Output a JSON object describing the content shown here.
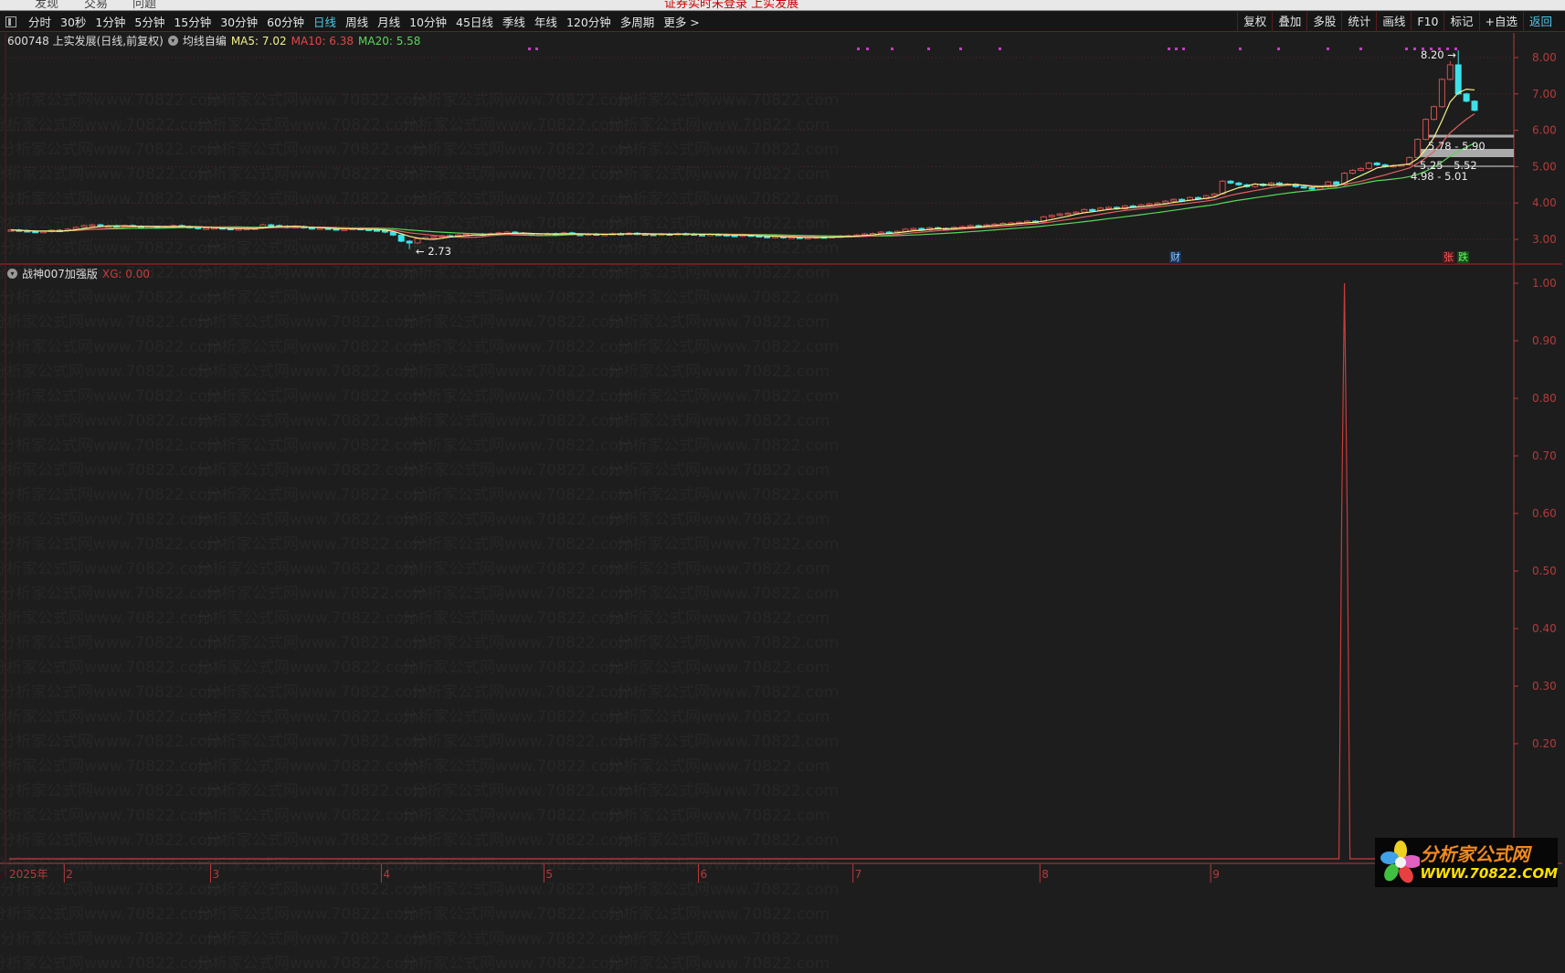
{
  "window": {
    "menu": [
      "发现",
      "交易",
      "问题"
    ],
    "title": "证券实时未登录 上实发展"
  },
  "toolbar": {
    "periods": [
      "分时",
      "30秒",
      "1分钟",
      "5分钟",
      "15分钟",
      "30分钟",
      "60分钟",
      "日线",
      "周线",
      "月线",
      "10分钟",
      "45日线",
      "季线",
      "年线",
      "120分钟",
      "多周期",
      "更多 >"
    ],
    "active_period": "日线",
    "actions": [
      "复权",
      "叠加",
      "多股",
      "统计",
      "画线",
      "F10",
      "标记",
      "+自选",
      "返回"
    ]
  },
  "main_chart": {
    "title": "600748 上实发展(日线,前复权)",
    "ma_label": "均线自编",
    "ma5": "MA5: 7.02",
    "ma10": "MA10: 6.38",
    "ma20": "MA20: 5.58",
    "high_label": "8.20",
    "low_label": "2.73",
    "levels": [
      "5.78 - 5.90",
      "5.25 - 5.52",
      "4.98 - 5.01"
    ],
    "badges": {
      "cai": "财",
      "zhang": "张",
      "die": "跌"
    },
    "colors": {
      "up": "#d05050",
      "down": "#3fe0e8",
      "ma5": "#f5f08a",
      "ma10": "#e06060",
      "ma20": "#58d858",
      "dots": "#c040c0",
      "axis": "#b43b3b"
    }
  },
  "indicator": {
    "title": "战神007加强版",
    "value_label": "XG: 0.00"
  },
  "x_axis": {
    "labels": [
      "2025年",
      "2",
      "3",
      "4",
      "5",
      "6",
      "7",
      "8",
      "9"
    ]
  },
  "watermark": "分析家公式网www.70822.com",
  "logo": {
    "line1": "分析家公式网",
    "line2": "WWW.70822.COM"
  },
  "chart_data": [
    {
      "type": "candlestick",
      "ylim": [
        2.7,
        8.4
      ],
      "yticks": [
        "8.00",
        "7.00",
        "6.00",
        "5.00",
        "4.00",
        "3.00"
      ],
      "grid": true,
      "closes": [
        3.26,
        3.24,
        3.22,
        3.2,
        3.22,
        3.25,
        3.24,
        3.28,
        3.33,
        3.38,
        3.4,
        3.36,
        3.37,
        3.35,
        3.38,
        3.36,
        3.33,
        3.35,
        3.34,
        3.36,
        3.38,
        3.35,
        3.33,
        3.3,
        3.31,
        3.32,
        3.3,
        3.28,
        3.29,
        3.3,
        3.31,
        3.4,
        3.38,
        3.36,
        3.33,
        3.35,
        3.32,
        3.3,
        3.31,
        3.29,
        3.27,
        3.28,
        3.3,
        3.28,
        3.26,
        3.25,
        3.2,
        3.12,
        2.95,
        2.9,
        3.02,
        3.05,
        3.08,
        3.1,
        3.08,
        3.12,
        3.14,
        3.15,
        3.12,
        3.16,
        3.18,
        3.2,
        3.17,
        3.15,
        3.12,
        3.14,
        3.16,
        3.15,
        3.18,
        3.14,
        3.12,
        3.15,
        3.13,
        3.14,
        3.16,
        3.15,
        3.17,
        3.15,
        3.14,
        3.13,
        3.15,
        3.14,
        3.16,
        3.15,
        3.13,
        3.12,
        3.14,
        3.13,
        3.11,
        3.1,
        3.12,
        3.1,
        3.08,
        3.06,
        3.08,
        3.05,
        3.06,
        3.04,
        3.05,
        3.07,
        3.06,
        3.08,
        3.09,
        3.1,
        3.12,
        3.15,
        3.16,
        3.2,
        3.18,
        3.22,
        3.28,
        3.3,
        3.26,
        3.32,
        3.3,
        3.28,
        3.33,
        3.35,
        3.38,
        3.36,
        3.4,
        3.42,
        3.44,
        3.45,
        3.47,
        3.5,
        3.48,
        3.62,
        3.66,
        3.7,
        3.72,
        3.75,
        3.82,
        3.8,
        3.86,
        3.88,
        3.84,
        3.92,
        3.9,
        3.95,
        3.98,
        4.0,
        4.05,
        4.1,
        4.08,
        4.15,
        4.12,
        4.2,
        4.25,
        4.6,
        4.55,
        4.5,
        4.45,
        4.52,
        4.48,
        4.55,
        4.5,
        4.52,
        4.45,
        4.42,
        4.38,
        4.45,
        4.58,
        4.5,
        4.82,
        4.9,
        4.95,
        5.1,
        5.05,
        5.0,
        5.03,
        5.05,
        5.25,
        5.75,
        6.3,
        6.65,
        7.4,
        7.8,
        7.0,
        6.8,
        6.55
      ],
      "high": 8.2,
      "low": 2.73,
      "month_start_index": {
        "2": 7,
        "3": 25,
        "4": 46,
        "5": 66,
        "6": 85,
        "7": 104,
        "8": 127,
        "9": 148
      }
    },
    {
      "type": "line",
      "name": "XG",
      "ylim": [
        0,
        1.05
      ],
      "yticks": [
        "1.00",
        "0.90",
        "0.80",
        "0.70",
        "0.60",
        "0.50",
        "0.40",
        "0.30",
        "0.20"
      ],
      "spike_index": 164,
      "spike_value": 1.0,
      "baseline": 0
    }
  ]
}
